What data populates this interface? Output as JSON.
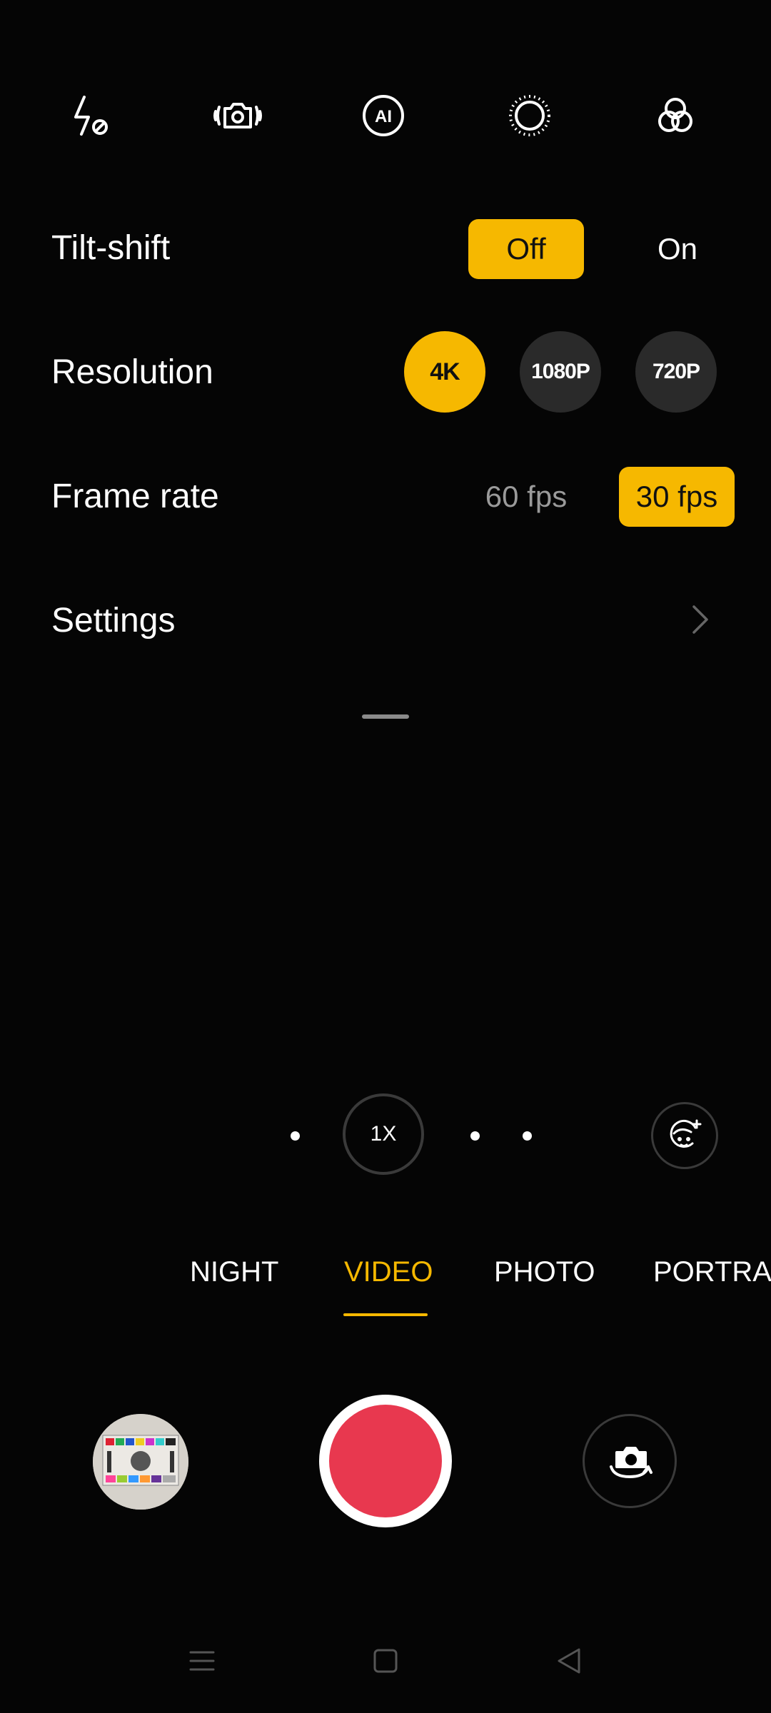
{
  "toolbar": {
    "icons": [
      "flash-off-icon",
      "stabilization-icon",
      "ai-icon",
      "light-sensor-icon",
      "filters-icon"
    ],
    "ai_text": "AI"
  },
  "settings": {
    "tilt_shift": {
      "label": "Tilt-shift",
      "off": "Off",
      "on": "On",
      "selected": "Off"
    },
    "resolution": {
      "label": "Resolution",
      "options": [
        "4K",
        "1080P",
        "720P"
      ],
      "selected": "4K"
    },
    "frame_rate": {
      "label": "Frame rate",
      "options": [
        "60 fps",
        "30 fps"
      ],
      "selected": "30 fps"
    },
    "settings_link": {
      "label": "Settings"
    }
  },
  "zoom": {
    "current": "1X"
  },
  "modes": {
    "items": [
      "NIGHT",
      "VIDEO",
      "PHOTO",
      "PORTRAIT"
    ],
    "active": "VIDEO"
  },
  "colors": {
    "accent": "#f6b800",
    "record": "#e8384f",
    "background": "#050505"
  }
}
